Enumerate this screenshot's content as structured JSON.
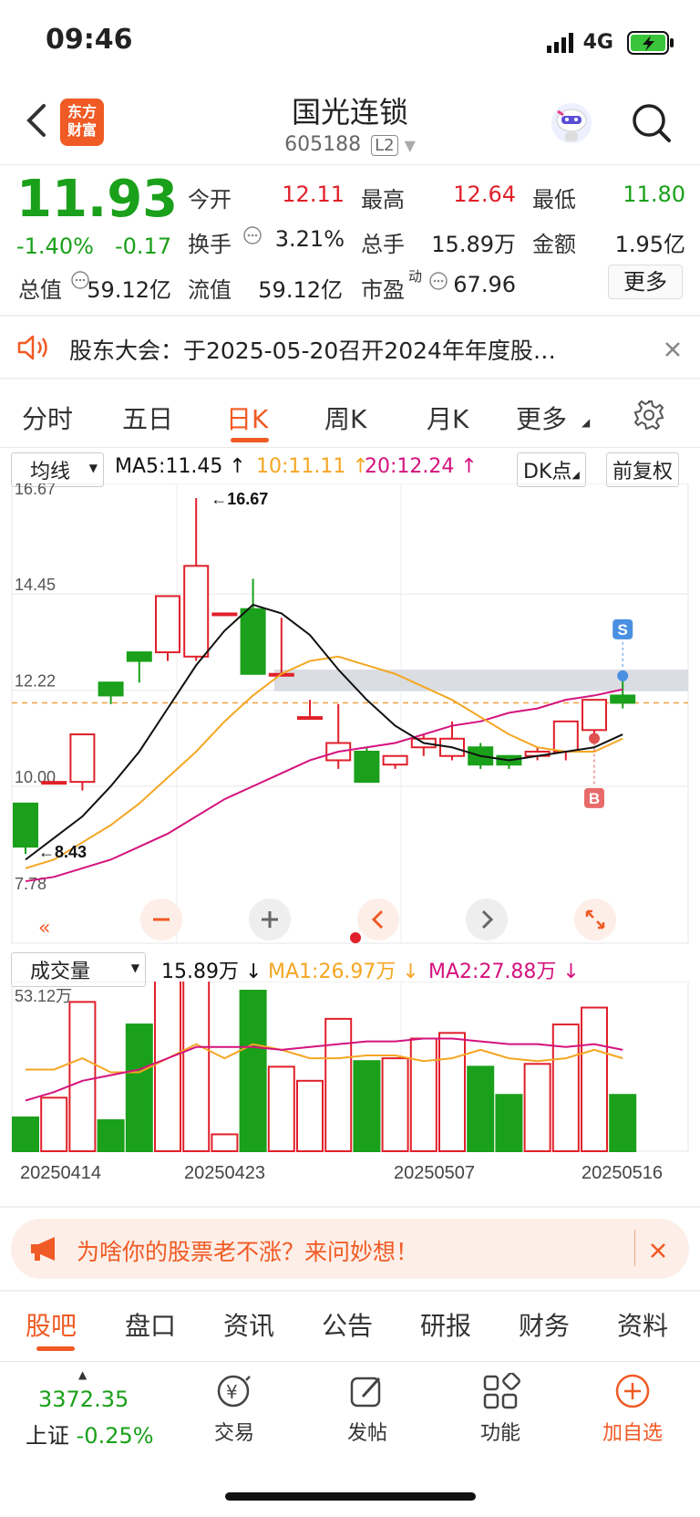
{
  "status": {
    "time": "09:46",
    "network": "4G"
  },
  "header": {
    "title": "国光连锁",
    "code": "605188",
    "level": "L2",
    "logo_line1": "东方",
    "logo_line2": "财富"
  },
  "quote": {
    "price": "11.93",
    "change_pct": "-1.40%",
    "change": "-0.17",
    "open_label": "今开",
    "open": "12.11",
    "high_label": "最高",
    "high": "12.64",
    "low_label": "最低",
    "low": "11.80",
    "turnover_label": "换手",
    "turnover": "3.21%",
    "volume_label": "总手",
    "volume": "15.89万",
    "amount_label": "金额",
    "amount": "1.95亿",
    "mcap_label": "总值",
    "mcap": "59.12亿",
    "float_label": "流值",
    "float": "59.12亿",
    "pe_label": "市盈",
    "pe_sup": "动",
    "pe": "67.96",
    "more": "更多"
  },
  "notice": {
    "text": "股东大会：于2025-05-20召开2024年年度股…"
  },
  "tabs": [
    "分时",
    "五日",
    "日K",
    "周K",
    "月K",
    "更多"
  ],
  "kline_bar": {
    "select": "均线",
    "ma5": "MA5:11.45",
    "ma10": "10:11.11",
    "ma20": "20:12.24",
    "dk": "DK点",
    "adjust": "前复权"
  },
  "chart_data": {
    "type": "candlestick",
    "y_ticks": [
      "16.67",
      "14.45",
      "12.22",
      "10.00",
      "7.78"
    ],
    "ylim": [
      7.78,
      16.67
    ],
    "max_label": "16.67",
    "min_label": "8.43",
    "current_price": 11.93,
    "candles": [
      {
        "o": 9.6,
        "c": 8.6,
        "h": 9.6,
        "l": 8.43
      },
      {
        "o": 10.1,
        "c": 10.1,
        "h": 10.1,
        "l": 10.1
      },
      {
        "o": 10.1,
        "c": 11.2,
        "h": 11.2,
        "l": 9.9
      },
      {
        "o": 12.4,
        "c": 12.1,
        "h": 12.4,
        "l": 11.9
      },
      {
        "o": 13.1,
        "c": 12.9,
        "h": 13.1,
        "l": 12.4
      },
      {
        "o": 13.1,
        "c": 14.4,
        "h": 14.4,
        "l": 12.9
      },
      {
        "o": 13.0,
        "c": 15.1,
        "h": 16.67,
        "l": 12.9
      },
      {
        "o": 14.0,
        "c": 14.0,
        "h": 14.0,
        "l": 14.0
      },
      {
        "o": 14.1,
        "c": 12.6,
        "h": 14.8,
        "l": 12.6
      },
      {
        "o": 12.6,
        "c": 12.6,
        "h": 13.9,
        "l": 12.6
      },
      {
        "o": 11.6,
        "c": 11.6,
        "h": 12.0,
        "l": 11.6
      },
      {
        "o": 10.6,
        "c": 11.0,
        "h": 11.9,
        "l": 10.4
      },
      {
        "o": 10.8,
        "c": 10.1,
        "h": 10.9,
        "l": 10.1
      },
      {
        "o": 10.5,
        "c": 10.7,
        "h": 10.7,
        "l": 10.4
      },
      {
        "o": 10.9,
        "c": 11.1,
        "h": 11.2,
        "l": 10.7
      },
      {
        "o": 10.7,
        "c": 11.1,
        "h": 11.5,
        "l": 10.6
      },
      {
        "o": 10.9,
        "c": 10.5,
        "h": 11.0,
        "l": 10.4
      },
      {
        "o": 10.7,
        "c": 10.5,
        "h": 10.7,
        "l": 10.4
      },
      {
        "o": 10.7,
        "c": 10.8,
        "h": 10.9,
        "l": 10.6
      },
      {
        "o": 10.8,
        "c": 11.5,
        "h": 11.5,
        "l": 10.6
      },
      {
        "o": 11.3,
        "c": 12.0,
        "h": 12.0,
        "l": 11.0
      },
      {
        "o": 12.1,
        "c": 11.93,
        "h": 12.64,
        "l": 11.8
      }
    ],
    "ma5": [
      8.3,
      8.8,
      9.3,
      10.0,
      10.8,
      11.8,
      12.8,
      13.6,
      14.2,
      14.0,
      13.5,
      12.7,
      12.0,
      11.4,
      11.0,
      10.9,
      10.7,
      10.6,
      10.7,
      10.8,
      10.9,
      11.2
    ],
    "ma10": [
      8.1,
      8.3,
      8.7,
      9.1,
      9.6,
      10.2,
      10.8,
      11.5,
      12.1,
      12.6,
      12.9,
      13.0,
      12.8,
      12.6,
      12.3,
      12.0,
      11.6,
      11.2,
      10.9,
      10.8,
      10.8,
      11.1
    ],
    "ma20": [
      7.8,
      7.9,
      8.1,
      8.3,
      8.6,
      8.9,
      9.3,
      9.7,
      10.0,
      10.3,
      10.6,
      10.8,
      10.9,
      11.0,
      11.2,
      11.4,
      11.5,
      11.7,
      11.8,
      12.0,
      12.1,
      12.24
    ],
    "volume_title": "成交量",
    "vol": "15.89万",
    "ma1": "MA1:26.97万",
    "ma2": "MA2:27.88万",
    "vol_max_label": "53.12万",
    "volumes": [
      12,
      19,
      53,
      11,
      45,
      65,
      64,
      6,
      57,
      30,
      25,
      47,
      32,
      33,
      40,
      42,
      30,
      20,
      31,
      45,
      51,
      20
    ],
    "vol_ma1": [
      29,
      29,
      33,
      28,
      28,
      33,
      38,
      33,
      38,
      36,
      33,
      33,
      34,
      34,
      32,
      33,
      36,
      33,
      32,
      33,
      36,
      33
    ],
    "vol_ma2": [
      18,
      21,
      25,
      27,
      29,
      33,
      37,
      37,
      37,
      36,
      37,
      38,
      39,
      39,
      40,
      40,
      39,
      38,
      38,
      37,
      38,
      36
    ],
    "x_labels": [
      "20250414",
      "20250423",
      "20250507",
      "20250516"
    ],
    "markers": {
      "sell": "S",
      "buy": "B"
    }
  },
  "promo": {
    "text": "为啥你的股票老不涨？来问妙想！"
  },
  "bottom_tabs": [
    "股吧",
    "盘口",
    "资讯",
    "公告",
    "研报",
    "财务",
    "资料"
  ],
  "index": {
    "value": "3372.35",
    "name": "上证",
    "pct": "-0.25%"
  },
  "nav": [
    "交易",
    "发帖",
    "功能",
    "加自选"
  ],
  "colors": {
    "accent": "#f05a24",
    "up": "#e0202a",
    "down": "#1aa01a",
    "ma5": "#111111",
    "ma10": "#f5a623",
    "ma20": "#d4127e"
  }
}
